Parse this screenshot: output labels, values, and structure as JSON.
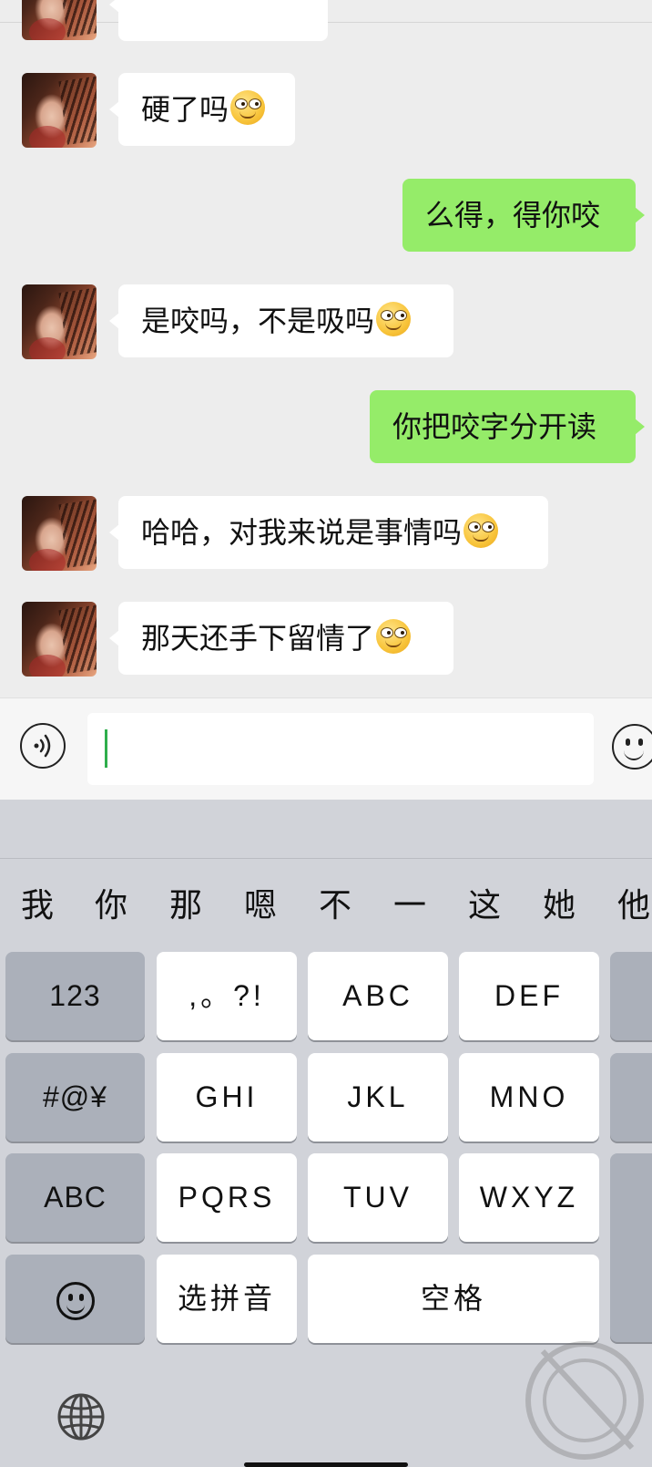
{
  "chat": {
    "messages": [
      {
        "side": "in",
        "text": "硬了吗",
        "emoji": "smirk-emoji"
      },
      {
        "side": "out",
        "text": "么得，得你咬"
      },
      {
        "side": "in",
        "text": "是咬吗，不是吸吗",
        "emoji": "smirk-emoji"
      },
      {
        "side": "out",
        "text": "你把咬字分开读"
      },
      {
        "side": "in",
        "text": "哈哈，对我来说是事情吗",
        "emoji": "smirk-emoji"
      },
      {
        "side": "in",
        "text": "那天还手下留情了",
        "emoji": "smirk-emoji"
      }
    ]
  },
  "input": {
    "value": "",
    "voice_icon": "voice-icon",
    "emoji_icon": "emoji-face-icon"
  },
  "keyboard": {
    "candidates": [
      "我",
      "你",
      "那",
      "嗯",
      "不",
      "一",
      "这",
      "她",
      "他"
    ],
    "rows": [
      [
        "123",
        ",。?!",
        "ABC",
        "DEF"
      ],
      [
        "#@¥",
        "GHI",
        "JKL",
        "MNO"
      ],
      [
        "ABC",
        "PQRS",
        "TUV",
        "WXYZ"
      ]
    ],
    "bottom": {
      "emoji_icon": "emoji-face-icon",
      "pinyin_label": "选拼音",
      "space_label": "空格"
    },
    "globe_icon": "globe-icon"
  },
  "colors": {
    "chat_bg": "#ededed",
    "bubble_out": "#95ec69",
    "bubble_in": "#ffffff",
    "keyboard_bg": "#d1d3d9",
    "key_dark": "#abb0ba",
    "caret": "#2fae4c"
  }
}
